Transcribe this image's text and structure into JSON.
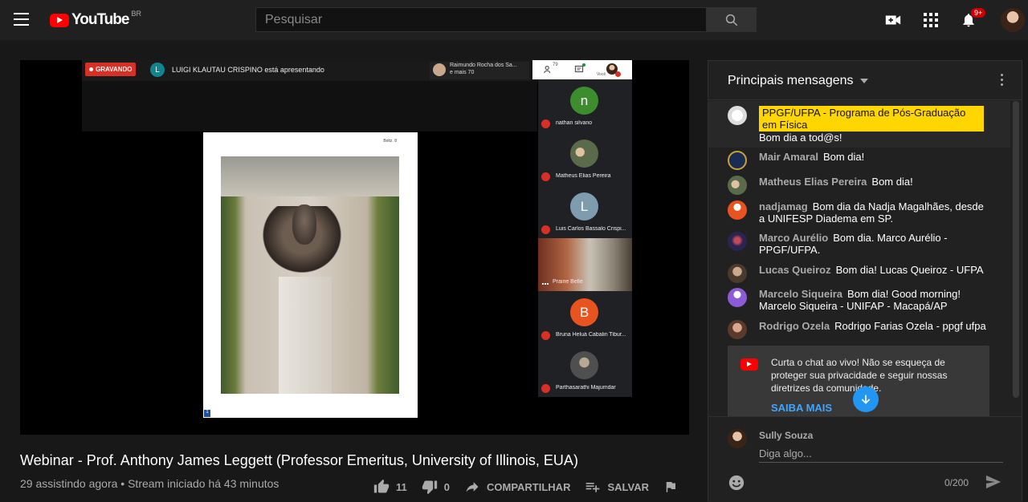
{
  "header": {
    "logo_text": "YouTube",
    "country": "BR",
    "search_placeholder": "Pesquisar",
    "notif_count": "9+"
  },
  "meet": {
    "recording": "GRAVANDO",
    "presenter_initial": "L",
    "presenter_text": "LUIGI KLAUTAU CRISPINO está apresentando",
    "participants_line1": "Raimundo Rocha dos Sa...",
    "participants_line2": "e mais 70",
    "participant_count": "79",
    "self_label": "Você",
    "slide_tag": "Boltz. 8",
    "slide_number": "1",
    "tiles": [
      {
        "initial": "n",
        "name": "nathan silvano",
        "color": "#3d8d2f"
      },
      {
        "initial": "",
        "name": "Matheus Elias Pereira",
        "color": "#6b7d5c"
      },
      {
        "initial": "L",
        "name": "Luis Carlos Bassalo Crispi...",
        "color": "#7f9cae"
      },
      {
        "initial": "",
        "name": "Prairie Belle",
        "color": "#000000"
      },
      {
        "initial": "B",
        "name": "Bruna Heluá Cabalin Tibur...",
        "color": "#e8531f"
      },
      {
        "initial": "",
        "name": "Parthasarathi Majumdar",
        "color": "#6c6c6c"
      }
    ]
  },
  "video": {
    "title": "Webinar - Prof. Anthony James Leggett (Professor Emeritus, University of Illinois, EUA)",
    "meta": "29 assistindo agora • Stream iniciado há 43 minutos",
    "likes": "11",
    "dislikes": "0",
    "share": "COMPARTILHAR",
    "save": "SALVAR"
  },
  "chat": {
    "header": "Principais mensagens",
    "pinned": {
      "author": "PPGF/UFPA - Programa de Pós-Graduação em Física",
      "text": "Bom dia a tod@s!"
    },
    "messages": [
      {
        "author": "Mair Amaral",
        "text": "Bom dia!"
      },
      {
        "author": "Matheus Elias Pereira",
        "text": "Bom dia!"
      },
      {
        "author": "nadjamag",
        "text": "Bom dia da Nadja Magalhães, desde a UNIFESP Diadema em SP."
      },
      {
        "author": "Marco Aurélio",
        "text": "Bom dia. Marco Aurélio - PPGF/UFPA."
      },
      {
        "author": "Lucas Queiroz",
        "text": "Bom dia! Lucas Queiroz - UFPA"
      },
      {
        "author": "Marcelo Siqueira",
        "text": "Bom dia! Good morning! Marcelo Siqueira - UNIFAP - Macapá/AP"
      },
      {
        "author": "Rodrigo Ozela",
        "text": "Rodrigo Farias Ozela - ppgf ufpa"
      }
    ],
    "notice_text": "Curta o chat ao vivo! Não se esqueça de proteger sua privacidade e seguir nossas diretrizes da comunidade.",
    "notice_link": "SAIBA MAIS",
    "me_name": "Sully Souza",
    "input_placeholder": "Diga algo...",
    "char_count": "0/200"
  }
}
